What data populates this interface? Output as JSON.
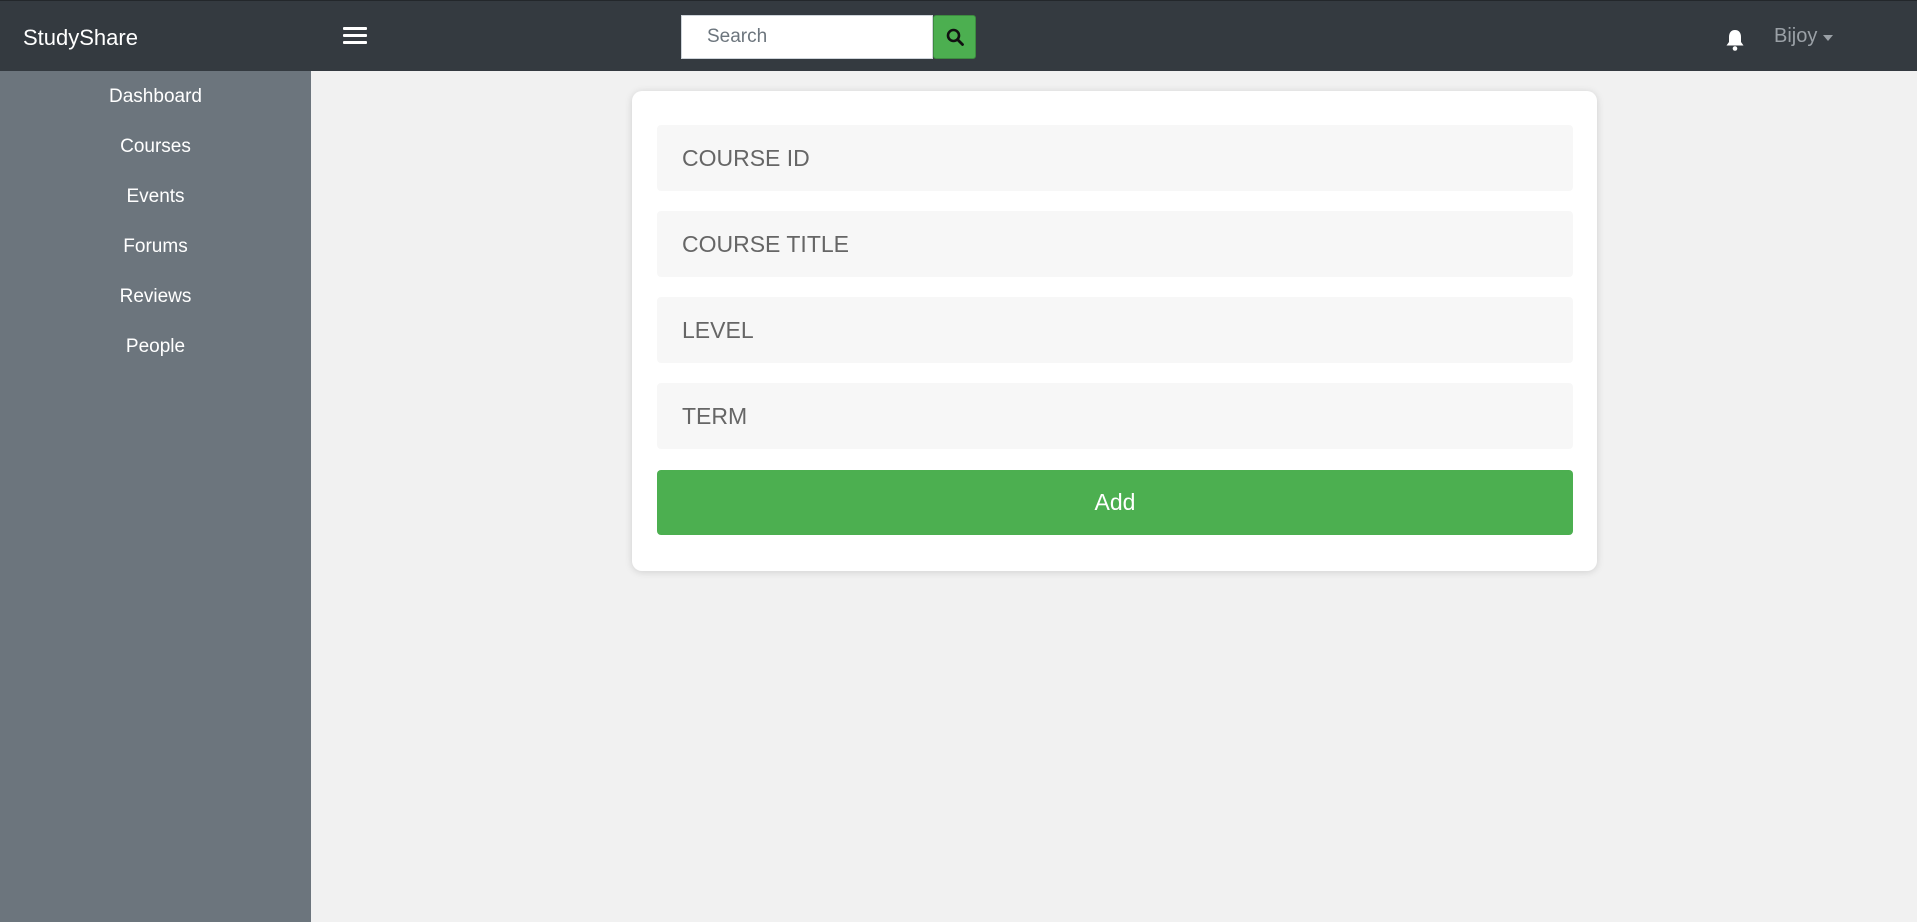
{
  "app": {
    "brand": "StudyShare"
  },
  "header": {
    "search": {
      "placeholder": "Search",
      "value": ""
    },
    "user": {
      "name": "Bijoy"
    }
  },
  "sidebar": {
    "items": [
      {
        "label": "Dashboard"
      },
      {
        "label": "Courses"
      },
      {
        "label": "Events"
      },
      {
        "label": "Forums"
      },
      {
        "label": "Reviews"
      },
      {
        "label": "People"
      }
    ]
  },
  "form": {
    "course_id": {
      "placeholder": "COURSE ID",
      "value": ""
    },
    "course_title": {
      "placeholder": "COURSE TITLE",
      "value": ""
    },
    "level": {
      "placeholder": "LEVEL",
      "value": ""
    },
    "term": {
      "placeholder": "TERM",
      "value": ""
    },
    "submit_label": "Add"
  },
  "icons": {
    "menu": "hamburger-menu-icon",
    "search": "search-icon",
    "notifications": "bell-icon",
    "dropdown": "caret-down-icon"
  },
  "colors": {
    "topbar": "#343a40",
    "sidebar": "#6c757d",
    "accent": "#4caf50",
    "background": "#f1f1f1"
  }
}
